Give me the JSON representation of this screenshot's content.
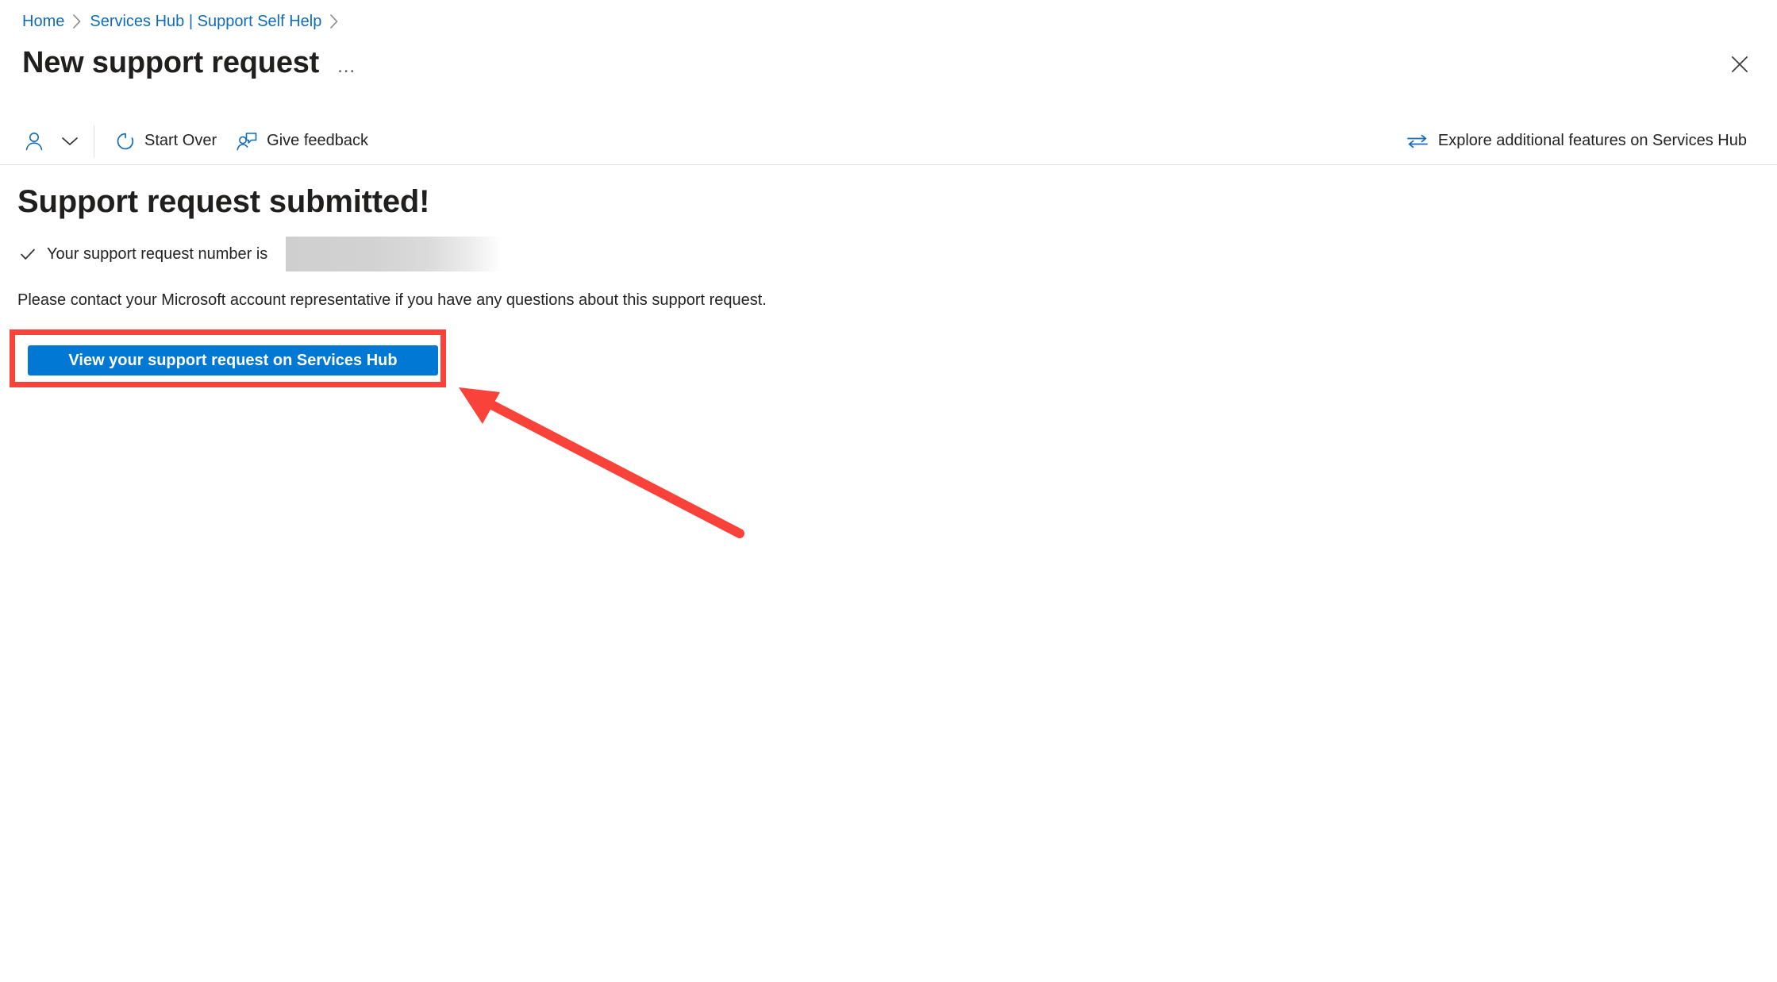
{
  "breadcrumb": {
    "items": [
      {
        "label": "Home",
        "icon": "none"
      },
      {
        "label": "Services Hub | Support Self Help",
        "icon": "none"
      }
    ],
    "separator": "chevron-right-icon"
  },
  "header": {
    "title": "New support request",
    "overflow_label": "…",
    "close_label": "Close"
  },
  "toolbar": {
    "persona": {
      "icon": "person-icon",
      "chevron": "chevron-down-icon"
    },
    "items": [
      {
        "label": "Start Over",
        "icon": "refresh-icon"
      },
      {
        "label": "Give feedback",
        "icon": "person-feedback-icon"
      }
    ],
    "right_item": {
      "label": "Explore additional features on Services Hub",
      "icon": "swap-arrows-icon"
    }
  },
  "main": {
    "heading": "Support request submitted!",
    "confirmation": {
      "icon": "checkmark-icon",
      "text": "Your support request number is",
      "value_redacted": true
    },
    "note": "Please contact your Microsoft account representative if you have any questions about this support request.",
    "primary_button": "View your support request on Services Hub"
  },
  "annotations": {
    "highlight_color": "#f9423a",
    "arrow": "points-to-primary-button"
  },
  "colors": {
    "link": "#0f6cbd",
    "accent": "#0078d4",
    "icon_blue": "#0f6cbd",
    "text": "#242424",
    "divider": "#e1dfdd",
    "annotation_red": "#f9423a",
    "redaction_gray": "#d2d2d2"
  }
}
